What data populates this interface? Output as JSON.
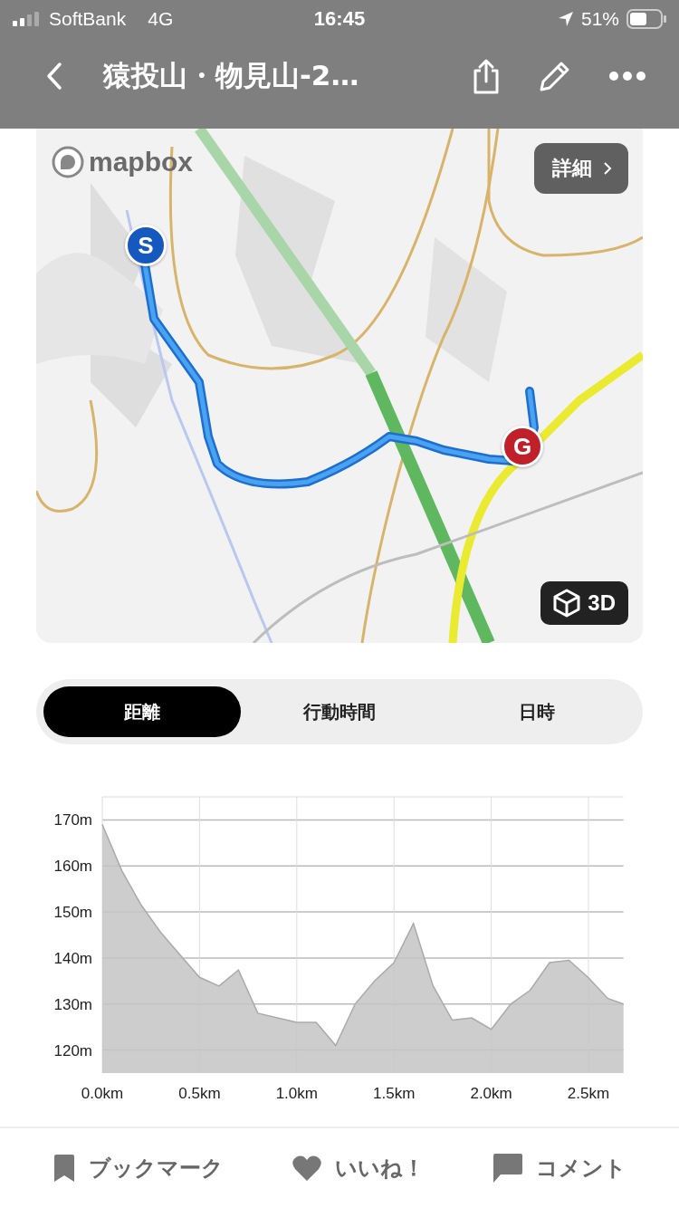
{
  "status_bar": {
    "carrier": "SoftBank",
    "network": "4G",
    "time": "16:45",
    "battery": "51%"
  },
  "nav": {
    "title": "猿投山・物見山-2…"
  },
  "map": {
    "logo": "mapbox",
    "detail_button": "詳細",
    "view_button": "3D",
    "start_marker": "S",
    "goal_marker": "G"
  },
  "tabs": [
    {
      "label": "距離",
      "selected": true
    },
    {
      "label": "行動時間",
      "selected": false
    },
    {
      "label": "日時",
      "selected": false
    }
  ],
  "elevation": {
    "chart_data": {
      "type": "area",
      "x": [
        0,
        0.1,
        0.2,
        0.3,
        0.4,
        0.5,
        0.6,
        0.7,
        0.8,
        0.9,
        1.0,
        1.1,
        1.2,
        1.3,
        1.4,
        1.5,
        1.6,
        1.7,
        1.8,
        1.9,
        2.0,
        2.1,
        2.2,
        2.3,
        2.4,
        2.5,
        2.6,
        2.68
      ],
      "series": [
        {
          "color": "#c4c4c4",
          "values": [
            169,
            159,
            151.5,
            145.6,
            140.7,
            135.8,
            133.9,
            137.4,
            128,
            127,
            126,
            126,
            121,
            130,
            135,
            139,
            147.5,
            134,
            126.5,
            127,
            124.5,
            130,
            133,
            139,
            139.5,
            135.7,
            131.2,
            130
          ]
        }
      ],
      "grid": true,
      "xlim": [
        0,
        2.68
      ],
      "ylim": [
        115,
        175
      ],
      "xticks": [
        {
          "value": 0,
          "label": "0.0km"
        },
        {
          "value": 0.5,
          "label": "0.5km"
        },
        {
          "value": 1,
          "label": "1.0km"
        },
        {
          "value": 1.5,
          "label": "1.5km"
        },
        {
          "value": 2,
          "label": "2.0km"
        },
        {
          "value": 2.5,
          "label": "2.5km"
        }
      ],
      "yticks": [
        {
          "value": 120,
          "label": "120m"
        },
        {
          "value": 130,
          "label": "130m"
        },
        {
          "value": 140,
          "label": "140m"
        },
        {
          "value": 150,
          "label": "150m"
        },
        {
          "value": 160,
          "label": "160m"
        },
        {
          "value": 170,
          "label": "170m"
        }
      ]
    }
  },
  "actions": [
    "ブックマーク",
    "いいね！",
    "コメント"
  ]
}
